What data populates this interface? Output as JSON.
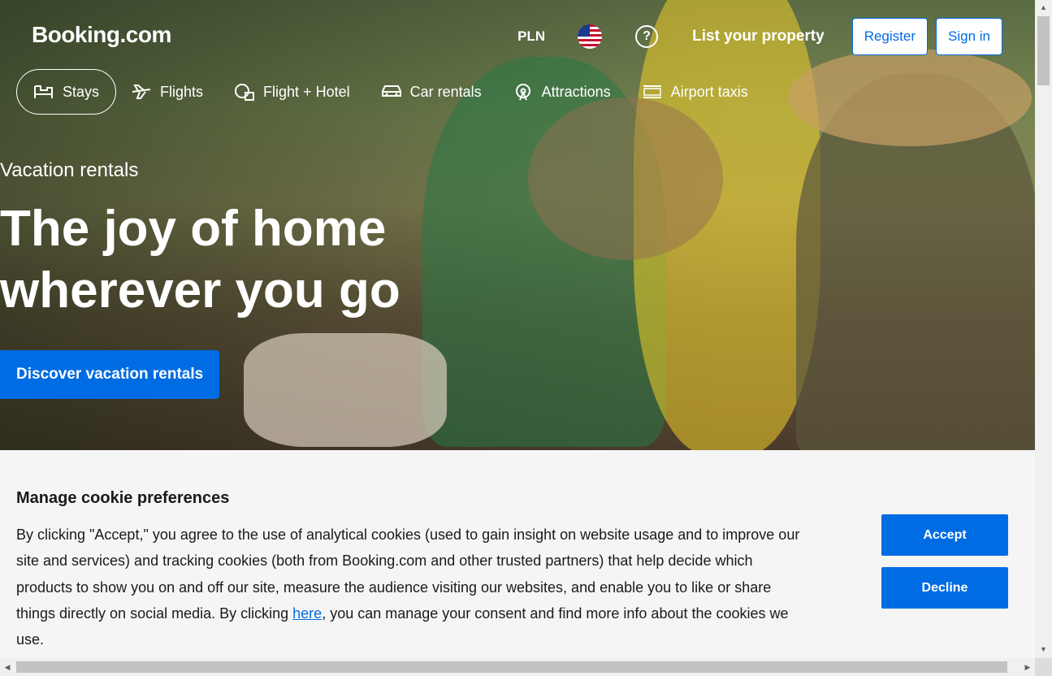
{
  "header": {
    "logo": "Booking.com",
    "currency": "PLN",
    "help_symbol": "?",
    "list_property": "List your property",
    "register": "Register",
    "sign_in": "Sign in"
  },
  "categories": [
    {
      "label": "Stays",
      "icon": "bed-icon"
    },
    {
      "label": "Flights",
      "icon": "plane-icon"
    },
    {
      "label": "Flight + Hotel",
      "icon": "flight-hotel-icon"
    },
    {
      "label": "Car rentals",
      "icon": "car-icon"
    },
    {
      "label": "Attractions",
      "icon": "attractions-icon"
    },
    {
      "label": "Airport taxis",
      "icon": "taxi-icon"
    }
  ],
  "hero": {
    "kicker": "Vacation rentals",
    "headline": "The joy of home wherever you go",
    "cta": "Discover vacation rentals"
  },
  "cookie": {
    "title": "Manage cookie preferences",
    "text_before": "By clicking \"Accept,\" you agree to the use of analytical cookies (used to gain insight on website usage and to improve our site and services) and tracking cookies (both from Booking.com and other trusted partners) that help decide which products to show you on and off our site, measure the audience visiting our websites, and enable you to like or share things directly on social media. By clicking ",
    "link": "here",
    "text_after": ", you can manage your consent and find more info about the cookies we use.",
    "accept": "Accept",
    "decline": "Decline"
  },
  "colors": {
    "brand_blue": "#006ce4"
  }
}
